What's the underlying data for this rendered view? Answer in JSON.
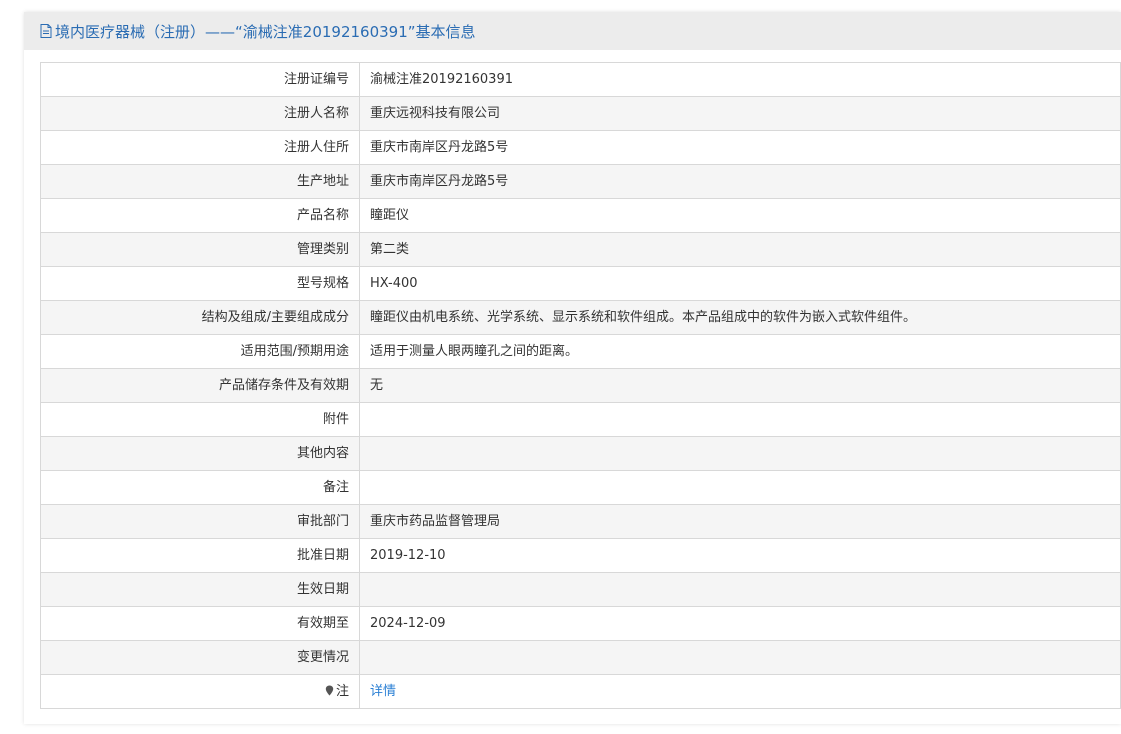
{
  "header": {
    "title": "境内医疗器械（注册）——“渝械注准20192160391”基本信息"
  },
  "rows": [
    {
      "label": "注册证编号",
      "value": "渝械注准20192160391"
    },
    {
      "label": "注册人名称",
      "value": "重庆远视科技有限公司"
    },
    {
      "label": "注册人住所",
      "value": "重庆市南岸区丹龙路5号"
    },
    {
      "label": "生产地址",
      "value": "重庆市南岸区丹龙路5号"
    },
    {
      "label": "产品名称",
      "value": "瞳距仪"
    },
    {
      "label": "管理类别",
      "value": "第二类"
    },
    {
      "label": "型号规格",
      "value": "HX-400"
    },
    {
      "label": "结构及组成/主要组成成分",
      "value": "瞳距仪由机电系统、光学系统、显示系统和软件组成。本产品组成中的软件为嵌入式软件组件。"
    },
    {
      "label": "适用范围/预期用途",
      "value": "适用于测量人眼两瞳孔之间的距离。"
    },
    {
      "label": "产品储存条件及有效期",
      "value": "无"
    },
    {
      "label": "附件",
      "value": ""
    },
    {
      "label": "其他内容",
      "value": ""
    },
    {
      "label": "备注",
      "value": ""
    },
    {
      "label": "审批部门",
      "value": "重庆市药品监督管理局"
    },
    {
      "label": "批准日期",
      "value": "2019-12-10"
    },
    {
      "label": "生效日期",
      "value": ""
    },
    {
      "label": "有效期至",
      "value": "2024-12-09"
    },
    {
      "label": "变更情况",
      "value": ""
    }
  ],
  "note_row": {
    "label": "注",
    "icon": "pin-icon",
    "link_text": "详情"
  },
  "colors": {
    "accent": "#2a6cb3",
    "link": "#2a7fd4",
    "header_bg": "#ececec",
    "alt_row_bg": "#f5f5f5"
  }
}
